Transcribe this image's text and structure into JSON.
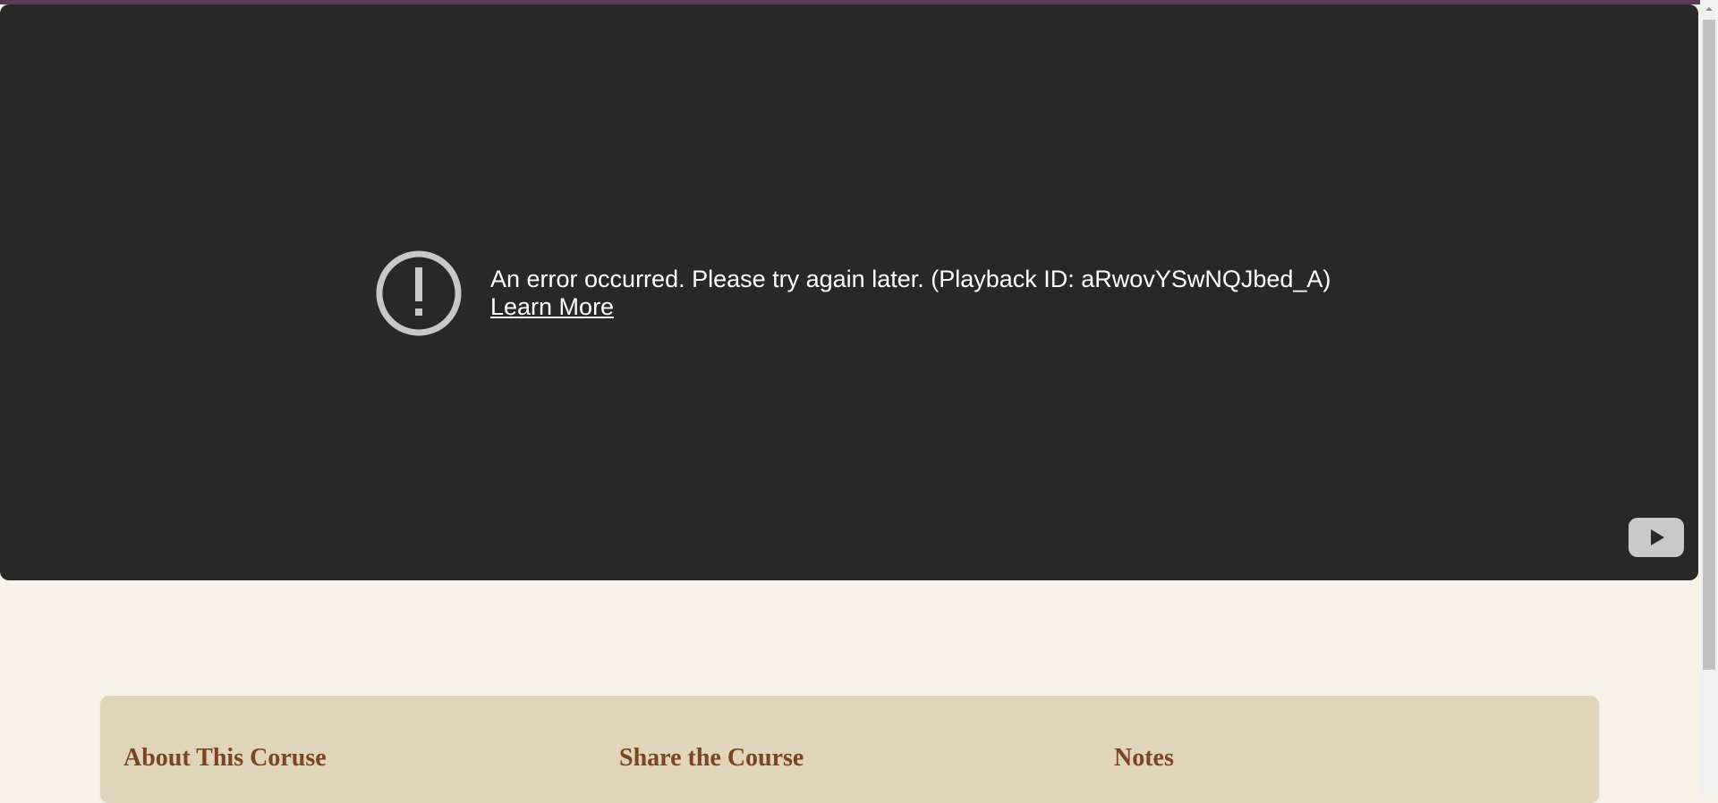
{
  "video_player": {
    "error_message": "An error occurred. Please try again later. (Playback ID: aRwovYSwNQJbed_A)",
    "learn_more_label": "Learn More",
    "error_icon": "exclamation-circle-icon",
    "logo_icon": "youtube-play-icon"
  },
  "course_info": {
    "about_heading": "About This Coruse",
    "share_heading": "Share the Course",
    "notes_heading": "Notes"
  },
  "colors": {
    "page_background": "#f8f3e8",
    "player_background": "#282828",
    "card_background": "#e0d4bb",
    "heading_color": "#7a4522"
  }
}
